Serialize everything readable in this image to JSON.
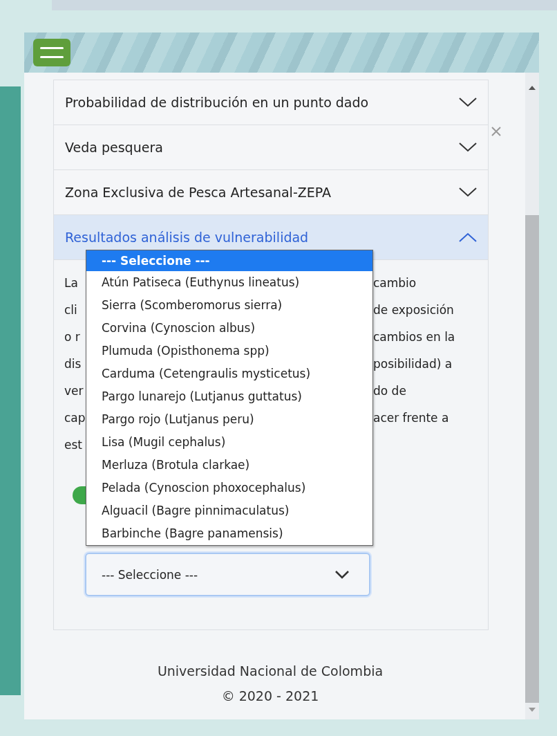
{
  "accordion": [
    {
      "title": "Probabilidad de distribución en un punto dado",
      "expanded": false
    },
    {
      "title": "Veda pesquera",
      "expanded": false
    },
    {
      "title": "Zona Exclusiva de Pesca Artesanal-ZEPA",
      "expanded": false
    },
    {
      "title": "Resultados análisis de vulnerabilidad",
      "expanded": true
    }
  ],
  "panel": {
    "paragraph_lines": [
      {
        "left": "La",
        "right": "cambio"
      },
      {
        "left": "cli",
        "right": "de exposición"
      },
      {
        "left": "o r",
        "right": "cambios en la"
      },
      {
        "left": "dis",
        "right": "posibilidad) a"
      },
      {
        "left": "ver",
        "right": "do de"
      },
      {
        "left": "cap",
        "right": "acer frente a"
      },
      {
        "left": "est"
      }
    ],
    "select": {
      "value": "--- Seleccione ---",
      "open": true,
      "options": [
        {
          "label": "--- Seleccione ---",
          "selected": true
        },
        {
          "label": "Atún Patiseca (Euthynus lineatus)",
          "selected": false
        },
        {
          "label": "Sierra (Scomberomorus sierra)",
          "selected": false
        },
        {
          "label": "Corvina (Cynoscion albus)",
          "selected": false
        },
        {
          "label": "Plumuda (Opisthonema spp)",
          "selected": false
        },
        {
          "label": "Carduma (Cetengraulis mysticetus)",
          "selected": false
        },
        {
          "label": "Pargo lunarejo (Lutjanus guttatus)",
          "selected": false
        },
        {
          "label": "Pargo rojo (Lutjanus peru)",
          "selected": false
        },
        {
          "label": "Lisa (Mugil cephalus)",
          "selected": false
        },
        {
          "label": "Merluza (Brotula clarkae)",
          "selected": false
        },
        {
          "label": "Pelada (Cynoscion phoxocephalus)",
          "selected": false
        },
        {
          "label": "Alguacil (Bagre pinnimaculatus)",
          "selected": false
        },
        {
          "label": "Barbinche (Bagre panamensis)",
          "selected": false
        }
      ]
    }
  },
  "footer": [
    "Universidad Nacional de Colombia",
    "© 2020 - 2021"
  ]
}
